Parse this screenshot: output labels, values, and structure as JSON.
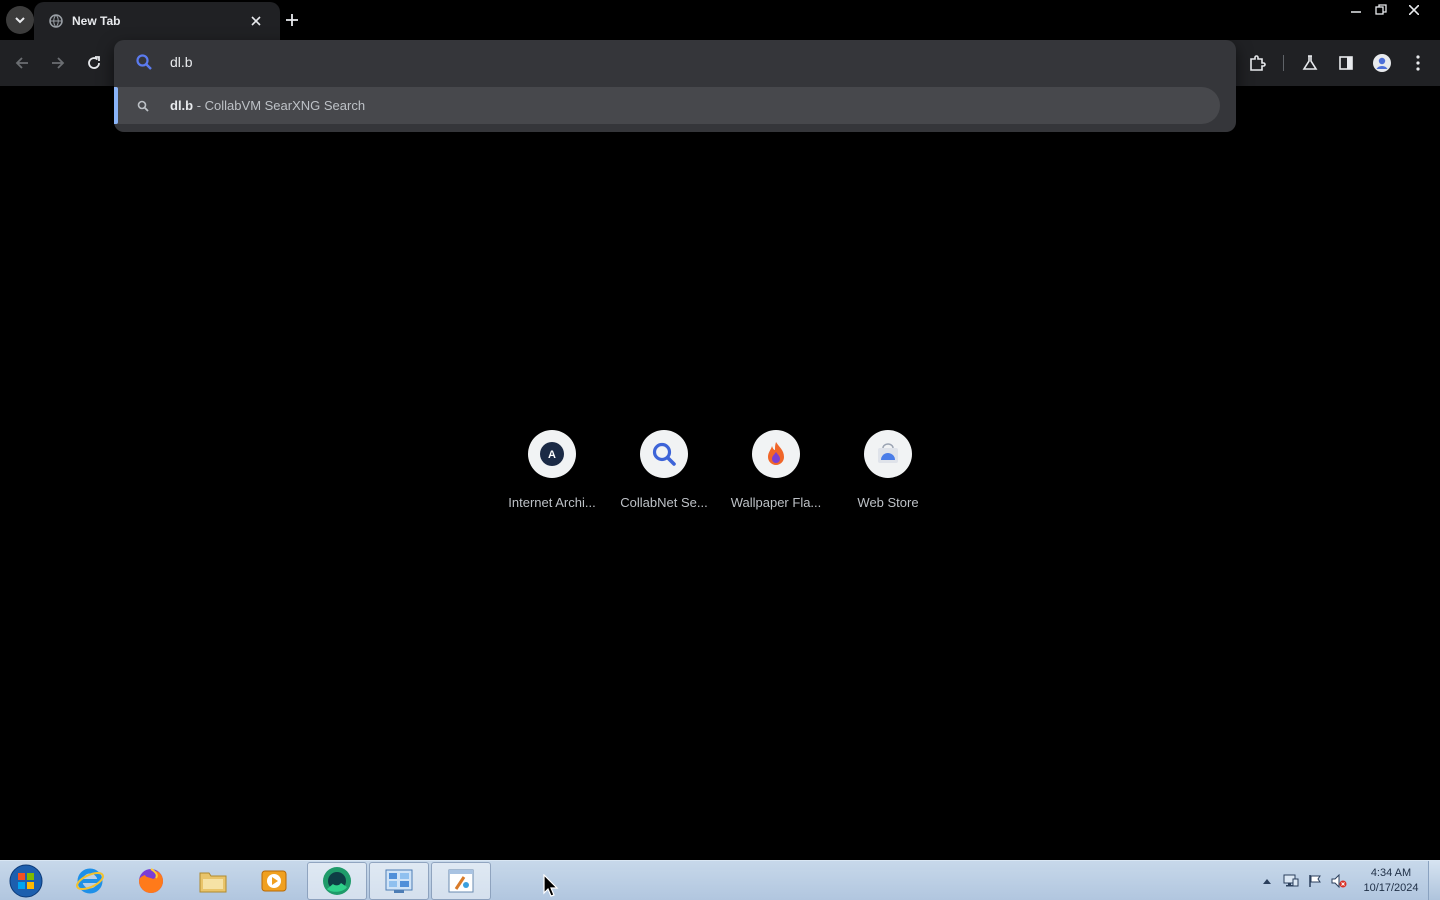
{
  "tab": {
    "title": "New Tab"
  },
  "omnibox": {
    "value": "dl.b",
    "suggestion": {
      "match": "dl.b",
      "description": " - CollabVM SearXNG Search"
    }
  },
  "shortcuts": [
    {
      "label": "Internet Archi...",
      "icon": "internet-archive-icon"
    },
    {
      "label": "CollabNet Se...",
      "icon": "magnifier-icon"
    },
    {
      "label": "Wallpaper Fla...",
      "icon": "flame-icon"
    },
    {
      "label": "Web Store",
      "icon": "web-store-icon"
    }
  ],
  "taskbar": {
    "apps": [
      "internet-explorer",
      "firefox",
      "file-explorer",
      "media-player",
      "chrome",
      "control-panel",
      "paint"
    ],
    "clock": {
      "time": "4:34 AM",
      "date": "10/17/2024"
    }
  },
  "colors": {
    "background": "#000000",
    "toolbar": "#202124",
    "accent": "#8ab4f8",
    "taskbar": "#b9cce2"
  }
}
